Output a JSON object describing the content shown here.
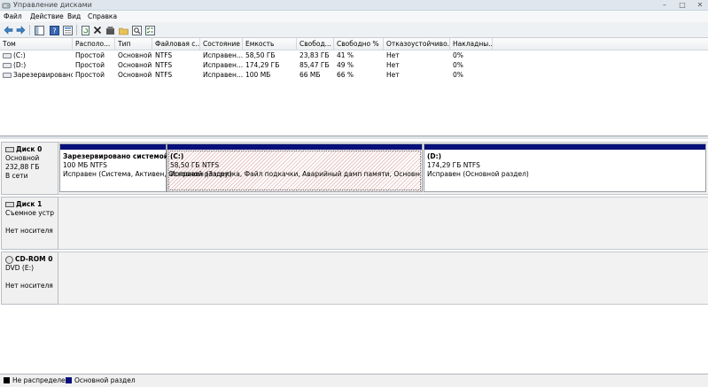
{
  "window": {
    "title": "Управление дисками",
    "icons": {
      "app": "disk-management-icon",
      "minimize": "minimize-icon",
      "maximize": "maximize-icon",
      "close": "close-icon"
    }
  },
  "menu": [
    "Файл",
    "Действие",
    "Вид",
    "Справка"
  ],
  "toolbar": {
    "icons": [
      "back-icon",
      "forward-icon",
      "console-tree-icon",
      "help-icon",
      "properties-icon",
      "refresh-icon",
      "delete-icon",
      "open-icon",
      "explore-icon",
      "search-icon",
      "tasks-icon"
    ]
  },
  "volume_list": {
    "columns": [
      "Том",
      "Располо...",
      "Тип",
      "Файловая с...",
      "Состояние",
      "Емкость",
      "Свобод...",
      "Свободно %",
      "Отказоустойчиво...",
      "Накладны..."
    ],
    "rows": [
      [
        "(C:)",
        "Простой",
        "Основной",
        "NTFS",
        "Исправен...",
        "58,50 ГБ",
        "23,83 ГБ",
        "41 %",
        "Нет",
        "0%"
      ],
      [
        "(D:)",
        "Простой",
        "Основной",
        "NTFS",
        "Исправен...",
        "174,29 ГБ",
        "85,47 ГБ",
        "49 %",
        "Нет",
        "0%"
      ],
      [
        "Зарезервировано...",
        "Простой",
        "Основной",
        "NTFS",
        "Исправен...",
        "100 МБ",
        "66 МБ",
        "66 %",
        "Нет",
        "0%"
      ]
    ]
  },
  "disks": [
    {
      "name": "Диск 0",
      "lines": [
        "Основной",
        "232,88 ГБ",
        "В сети"
      ],
      "partitions": [
        {
          "label": "Зарезервировано системой",
          "size": "100 МБ NTFS",
          "status": "Исправен (Система, Активен, Основной раздел)"
        },
        {
          "label": "(C:)",
          "size": "58,50 ГБ NTFS",
          "status": "Исправен (Загрузка, Файл подкачки, Аварийный дамп памяти, Основной раздел)"
        },
        {
          "label": "(D:)",
          "size": "174,29 ГБ NTFS",
          "status": "Исправен (Основной раздел)"
        }
      ]
    },
    {
      "name": "Диск 1",
      "lines": [
        "Съемное устройство",
        "",
        "Нет носителя"
      ]
    },
    {
      "name": "CD-ROM 0",
      "lines": [
        "DVD (E:)",
        "",
        "Нет носителя"
      ]
    }
  ],
  "legend": [
    {
      "label": "Не распределен",
      "color": "#000000"
    },
    {
      "label": "Основной раздел",
      "color": "#07107a"
    }
  ]
}
